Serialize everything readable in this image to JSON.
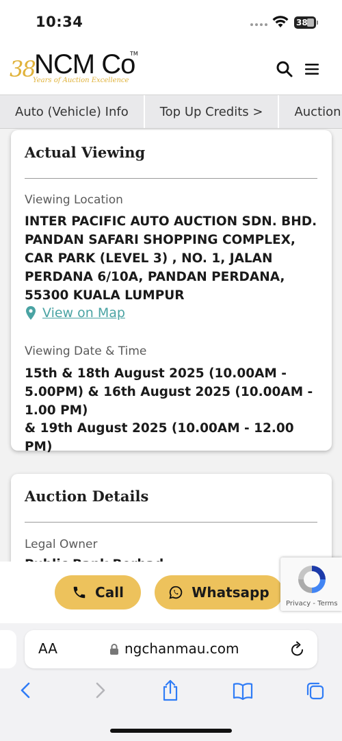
{
  "status_bar": {
    "time": "10:34",
    "battery": "38"
  },
  "header": {
    "logo_number": "38",
    "logo_name": "NCM Co",
    "logo_tm": "TM",
    "logo_tagline": "Years of Auction Excellence"
  },
  "tabs": [
    {
      "label": "Auto (Vehicle) Info"
    },
    {
      "label": "Top Up Credits >"
    },
    {
      "label": "Auction Details"
    }
  ],
  "viewing_card": {
    "title": "Actual Viewing",
    "location_label": "Viewing Location",
    "location_value": "INTER PACIFIC AUTO AUCTION SDN. BHD. PANDAN SAFARI SHOPPING COMPLEX, CAR PARK (LEVEL 3) , NO. 1, JALAN PERDANA 6/10A, PANDAN PERDANA, 55300 KUALA LUMPUR",
    "map_link": "View on Map",
    "datetime_label": "Viewing Date & Time",
    "datetime_line1": "15th & 18th August 2025 (10.00AM - 5.00PM) & 16th August 2025 (10.00AM - 1.00 PM)",
    "datetime_line2": "& 19th August 2025 (10.00AM - 12.00 PM)"
  },
  "auction_card": {
    "title": "Auction Details",
    "legal_owner_label": "Legal Owner",
    "legal_owner_value": "Public Bank Berhad"
  },
  "action_bar": {
    "call_label": "Call",
    "whatsapp_label": "Whatsapp"
  },
  "recaptcha": {
    "text": "Privacy - Terms"
  },
  "browser": {
    "aa": "AA",
    "url": "ngchanmau.com"
  },
  "colors": {
    "accent": "#edc25c",
    "link": "#4aa3a3",
    "logo_gold": "#e0b23a",
    "ios_blue": "#2f7cf6"
  }
}
